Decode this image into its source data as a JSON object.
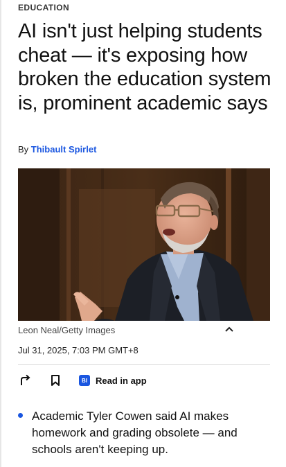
{
  "article": {
    "category": "EDUCATION",
    "headline": "AI isn't just helping students cheat — it's exposing how broken the education system is, prominent academic says",
    "byline_prefix": "By",
    "author": "Thibault Spirlet",
    "image": {
      "caption": "Leon Neal/Getty Images"
    },
    "timestamp": "Jul 31, 2025, 7:03 PM GMT+8",
    "actions": {
      "read_in_app_label": "Read in app",
      "app_badge": "BI"
    },
    "summary_bullets": [
      "Academic Tyler Cowen said AI makes homework and grading obsolete — and schools aren't keeping up."
    ]
  },
  "icons": {
    "share": "share-arrow-icon",
    "bookmark": "bookmark-icon",
    "caption_toggle": "chevron-up-icon"
  },
  "colors": {
    "accent": "#1a56e0",
    "text": "#111111"
  }
}
